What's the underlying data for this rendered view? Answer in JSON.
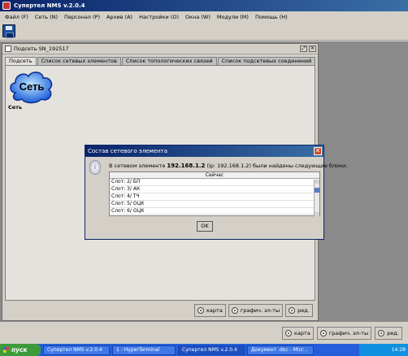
{
  "app": {
    "title": "Супертел NMS v.2.0.4"
  },
  "menu": [
    "Файл (F)",
    "Сеть (N)",
    "Персонал (P)",
    "Архив (A)",
    "Настройки (O)",
    "Окна (W)",
    "Модули (M)",
    "Помощь (H)"
  ],
  "child": {
    "title": "Подсеть SN_192517",
    "tabs": [
      "Подсеть",
      "Список сетевых элементов",
      "Список топологических связей",
      "Список подсетевых соединений"
    ],
    "cloud_text": "Сеть",
    "cloud_label": "Сеть",
    "buttons": [
      "карта",
      "графич. эл-ты",
      "ред."
    ]
  },
  "outer_buttons": [
    "карта",
    "графич. эл-ты",
    "ред."
  ],
  "dialog": {
    "title": "Состав сетевого элемента",
    "msg_pre": "В сетевом элементе",
    "ip": "192.168.1.2",
    "msg_post": "(ip: 192.168.1.2) были найдены следующие блоки:",
    "column": "Сейчас",
    "rows": [
      "Слот: 2/ БП",
      "Слот: 3/ АК",
      "Слот: 4/ ТЧ",
      "Слот: 5/ ОЦК",
      "Слот: 6/ ОЦК"
    ],
    "ok": "OK"
  },
  "taskbar": {
    "start": "пуск",
    "items": [
      "Супертел NMS v.2.0.4",
      "1 - HyperTerminal",
      "Супертел NMS v.2.0.4",
      "Документ .doc - Micr..."
    ],
    "clock": "14:28"
  }
}
